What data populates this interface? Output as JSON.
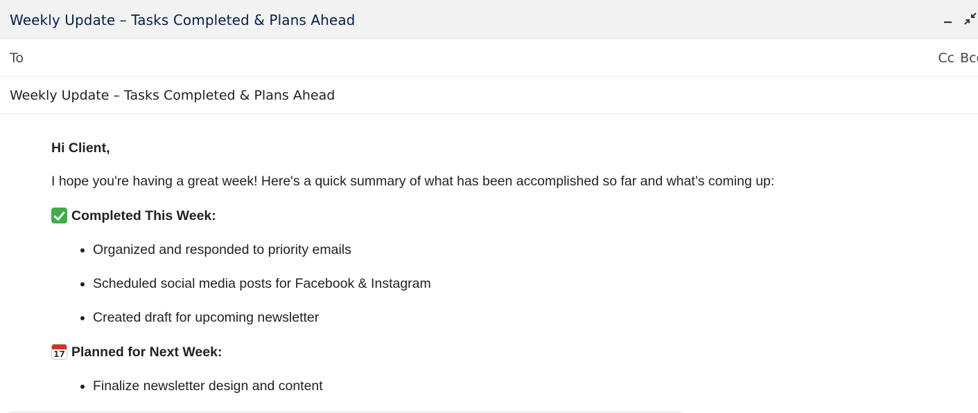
{
  "window": {
    "title": "Weekly Update – Tasks Completed & Plans Ahead",
    "minimize_icon": "minimize-icon",
    "exit_fullscreen_icon": "exit-fullscreen-icon"
  },
  "recipients": {
    "to_label": "To",
    "cc_label": "Cc",
    "bcc_label": "Bcc"
  },
  "subject": "Weekly Update – Tasks Completed & Plans Ahead",
  "body": {
    "greeting": "Hi Client,",
    "intro": "I hope you're having a great week! Here's a quick summary of what has been accomplished so far and what’s coming up:",
    "completed": {
      "icon": "check-mark-icon",
      "heading": "Completed This Week:",
      "items": [
        "Organized and responded to priority emails",
        "Scheduled social media posts for Facebook & Instagram",
        "Created draft for upcoming newsletter"
      ]
    },
    "planned": {
      "icon": "calendar-icon",
      "calendar_day": "17",
      "heading": "Planned for Next Week:",
      "items": [
        "Finalize newsletter design and content"
      ]
    }
  },
  "colors": {
    "titlebar_bg": "#f2f2f2",
    "title_text": "#041e49",
    "check_green": "#3fae49",
    "calendar_red": "#d93025"
  }
}
